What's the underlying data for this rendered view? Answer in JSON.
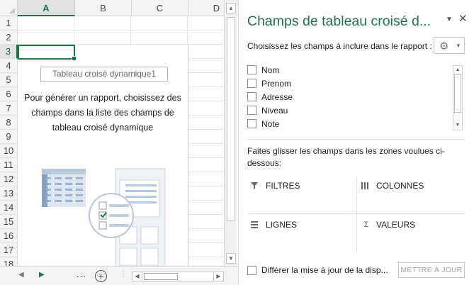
{
  "sheet": {
    "columns": [
      "A",
      "B",
      "C",
      "D"
    ],
    "rows": [
      "1",
      "2",
      "3",
      "4",
      "5",
      "6",
      "7",
      "8",
      "9",
      "10",
      "11",
      "12",
      "13",
      "14",
      "15",
      "16",
      "17",
      "18"
    ],
    "selected_column": "A",
    "selected_row": "3",
    "pivot_title": "Tableau croisé dynamique1",
    "pivot_message": "Pour générer un rapport, choisissez des champs dans la liste des champs de tableau croisé dynamique",
    "ellipsis": "...",
    "add_sheet": "+"
  },
  "pane": {
    "title": "Champs de tableau croisé d...",
    "choose_label": "Choisissez les champs à inclure dans le rapport :",
    "fields": [
      "Nom",
      "Prenom",
      "Adresse",
      "Niveau",
      "Note"
    ],
    "drag_label": "Faites glisser les champs dans les zones voulues ci-dessous:",
    "areas": {
      "filters": "FILTRES",
      "columns": "COLONNES",
      "rows": "LIGNES",
      "values": "VALEURS"
    },
    "defer_label": "Différer la mise à jour de la disp...",
    "update_button": "METTRE À JOUR"
  },
  "colors": {
    "accent": "#217346",
    "gridline": "#e2e2e2",
    "header_bg": "#f3f3f3"
  }
}
